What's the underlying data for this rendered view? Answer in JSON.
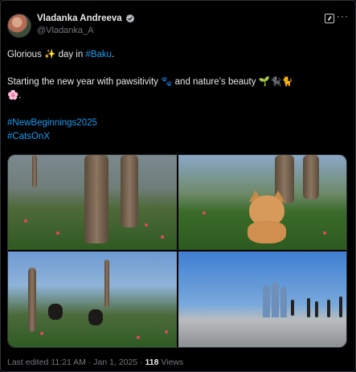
{
  "author": {
    "display_name": "Vladanka Andreeva",
    "handle": "@Vladanka_A"
  },
  "post": {
    "line1_prefix": "Glorious",
    "line1_emoji": "✨",
    "line1_mid": "day in",
    "line1_hashtag": "#Baku",
    "line1_suffix": ".",
    "line2_text": "Starting the new year with pawsitivity",
    "line2_emoji1": "🐾",
    "line2_mid": "and nature’s beauty",
    "line2_emoji2": "🌱🐈‍⬛🐈",
    "line3_emoji": "🌸",
    "line3_suffix": ".",
    "hashtag1": "#NewBeginnings2025",
    "hashtag2": "#CatsOnX"
  },
  "footer": {
    "edited_prefix": "Last edited",
    "time": "11:21 AM",
    "sep1": "·",
    "date": "Jan 1, 2025",
    "sep2": "·",
    "views_count": "118",
    "views_label": "Views"
  },
  "icons": {
    "verified": "verified-badge-icon",
    "grok": "grok-icon",
    "more": "more-icon"
  },
  "colors": {
    "background": "#000000",
    "text": "#e7e9ea",
    "secondary": "#71767b",
    "link": "#1d9bf0"
  }
}
